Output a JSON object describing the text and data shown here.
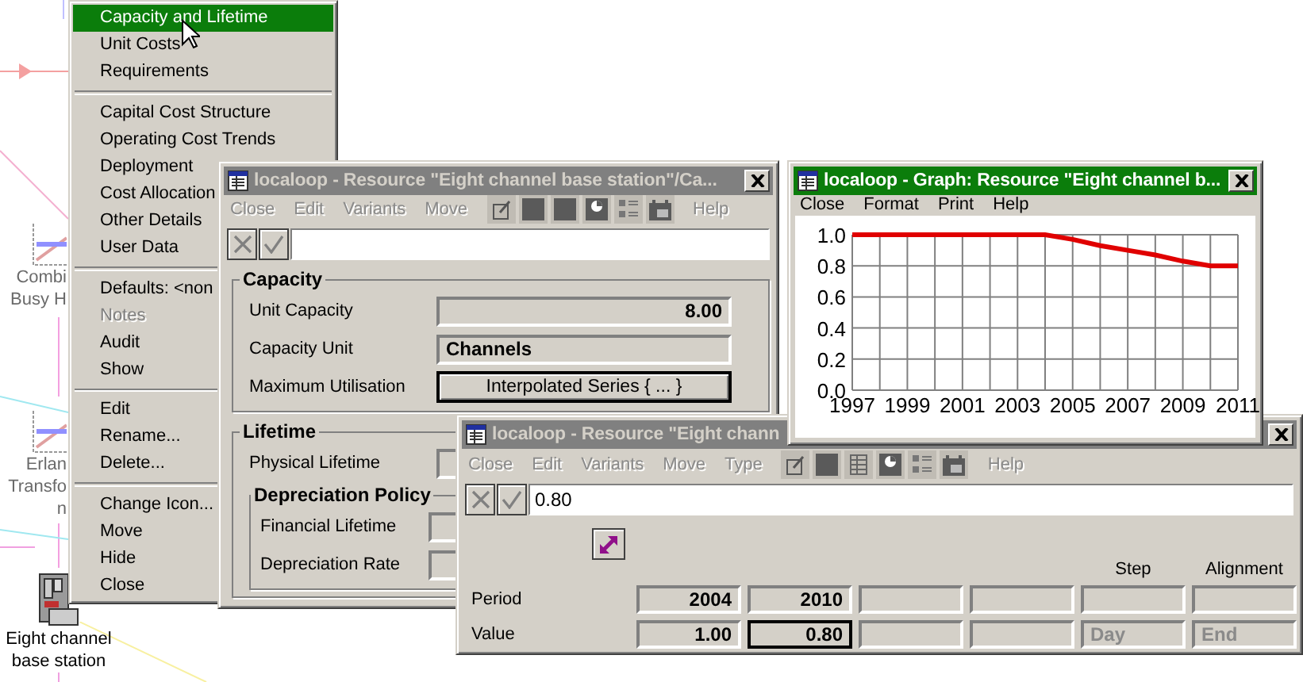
{
  "canvas": {
    "nodes": [
      {
        "kind": "chart",
        "lines": [
          "Combi",
          "Busy H"
        ]
      },
      {
        "kind": "chart",
        "lines": [
          "Erlan",
          "Transfo",
          "n"
        ]
      },
      {
        "kind": "station",
        "lines": [
          "Eight channel",
          "base station"
        ]
      }
    ]
  },
  "context_menu": {
    "items": [
      {
        "kind": "item",
        "label": "Capacity and Lifetime",
        "selected": true,
        "disabled": false
      },
      {
        "kind": "item",
        "label": "Unit Costs",
        "selected": false,
        "disabled": false
      },
      {
        "kind": "item",
        "label": "Requirements",
        "selected": false,
        "disabled": false
      },
      {
        "kind": "separator"
      },
      {
        "kind": "item",
        "label": "Capital Cost Structure",
        "selected": false,
        "disabled": false
      },
      {
        "kind": "item",
        "label": "Operating Cost Trends",
        "selected": false,
        "disabled": false
      },
      {
        "kind": "item",
        "label": "Deployment",
        "selected": false,
        "disabled": false
      },
      {
        "kind": "item",
        "label": "Cost Allocation",
        "selected": false,
        "disabled": false
      },
      {
        "kind": "item",
        "label": "Other Details",
        "selected": false,
        "disabled": false
      },
      {
        "kind": "item",
        "label": "User Data",
        "selected": false,
        "disabled": false
      },
      {
        "kind": "separator"
      },
      {
        "kind": "item",
        "label": "Defaults: <non",
        "selected": false,
        "disabled": false
      },
      {
        "kind": "item",
        "label": "Notes",
        "selected": false,
        "disabled": true
      },
      {
        "kind": "item",
        "label": "Audit",
        "selected": false,
        "disabled": false
      },
      {
        "kind": "item",
        "label": "Show",
        "selected": false,
        "disabled": false
      },
      {
        "kind": "separator"
      },
      {
        "kind": "item",
        "label": "Edit",
        "selected": false,
        "disabled": false
      },
      {
        "kind": "item",
        "label": "Rename...",
        "selected": false,
        "disabled": false
      },
      {
        "kind": "item",
        "label": "Delete...",
        "selected": false,
        "disabled": false
      },
      {
        "kind": "separator"
      },
      {
        "kind": "item",
        "label": "Change Icon...",
        "selected": false,
        "disabled": false
      },
      {
        "kind": "item",
        "label": "Move",
        "selected": false,
        "disabled": false
      },
      {
        "kind": "item",
        "label": "Hide",
        "selected": false,
        "disabled": false
      },
      {
        "kind": "item",
        "label": "Close",
        "selected": false,
        "disabled": false
      }
    ]
  },
  "resource_window": {
    "title": "localoop - Resource \"Eight channel base station\"/Ca...",
    "active": false,
    "menu": [
      {
        "label": "Close",
        "disabled": true
      },
      {
        "label": "Edit",
        "disabled": true
      },
      {
        "label": "Variants",
        "disabled": true
      },
      {
        "label": "Move",
        "disabled": true
      }
    ],
    "help": {
      "label": "Help",
      "disabled": true
    },
    "groups": [
      {
        "title": "Capacity",
        "rows": [
          {
            "label": "Unit Capacity",
            "kind": "number",
            "value": "8.00"
          },
          {
            "label": "Capacity Unit",
            "kind": "text",
            "value": "Channels"
          },
          {
            "label": "Maximum Utilisation",
            "kind": "button",
            "value": "Interpolated Series { ... }"
          }
        ]
      },
      {
        "title": "Lifetime",
        "rows": [
          {
            "label": "Physical Lifetime"
          }
        ],
        "subgroup": {
          "title": "Depreciation Policy",
          "rows": [
            {
              "label": "Financial Lifetime"
            },
            {
              "label": "Depreciation Rate"
            }
          ]
        }
      }
    ]
  },
  "graph_window": {
    "title": "localoop - Graph: Resource \"Eight channel b...",
    "active": true,
    "menu": [
      {
        "label": "Close",
        "disabled": false
      },
      {
        "label": "Format",
        "disabled": false
      },
      {
        "label": "Print",
        "disabled": false
      },
      {
        "label": "Help",
        "disabled": false
      }
    ],
    "chart_data": {
      "type": "line",
      "x": [
        1997,
        2004,
        2005,
        2006,
        2007,
        2008,
        2009,
        2010,
        2011
      ],
      "series": [
        {
          "color": "#e00000",
          "values": [
            1.0,
            1.0,
            0.97,
            0.93,
            0.9,
            0.87,
            0.83,
            0.8,
            0.8
          ]
        }
      ],
      "xlim": [
        1997,
        2011
      ],
      "ylim": [
        0,
        1
      ],
      "grid": true,
      "xticks": [
        1997,
        1999,
        2001,
        2003,
        2005,
        2007,
        2009,
        2011
      ],
      "yticks": [
        {
          "value": 0,
          "label": "0.0"
        },
        {
          "value": 0.2,
          "label": "0.2"
        },
        {
          "value": 0.4,
          "label": "0.4"
        },
        {
          "value": 0.6,
          "label": "0.6"
        },
        {
          "value": 0.8,
          "label": "0.8"
        },
        {
          "value": 1,
          "label": "1.0"
        }
      ]
    }
  },
  "series_window": {
    "title": "localoop - Resource \"Eight chann",
    "active": false,
    "menu": [
      {
        "label": "Close",
        "disabled": true
      },
      {
        "label": "Edit",
        "disabled": true
      },
      {
        "label": "Variants",
        "disabled": true
      },
      {
        "label": "Move",
        "disabled": true
      },
      {
        "label": "Type",
        "disabled": true
      }
    ],
    "help": {
      "label": "Help",
      "disabled": true
    },
    "entry": "0.80",
    "headers": {
      "step": "Step",
      "alignment": "Alignment"
    },
    "rows": [
      {
        "label": "Period",
        "cells": [
          {
            "value": "2004",
            "selected": false,
            "disabled": false
          },
          {
            "value": "2010",
            "selected": false,
            "disabled": false
          },
          {
            "selected": false
          },
          {
            "selected": false
          },
          {
            "selected": false
          },
          {
            "selected": false
          }
        ]
      },
      {
        "label": "Value",
        "cells": [
          {
            "value": "1.00",
            "selected": false,
            "disabled": false
          },
          {
            "value": "0.80",
            "selected": true,
            "disabled": false
          },
          {
            "selected": false
          },
          {
            "selected": false
          },
          {
            "value": "Day",
            "selected": false,
            "disabled": true
          },
          {
            "value": "End",
            "selected": false,
            "disabled": true
          }
        ]
      }
    ]
  }
}
